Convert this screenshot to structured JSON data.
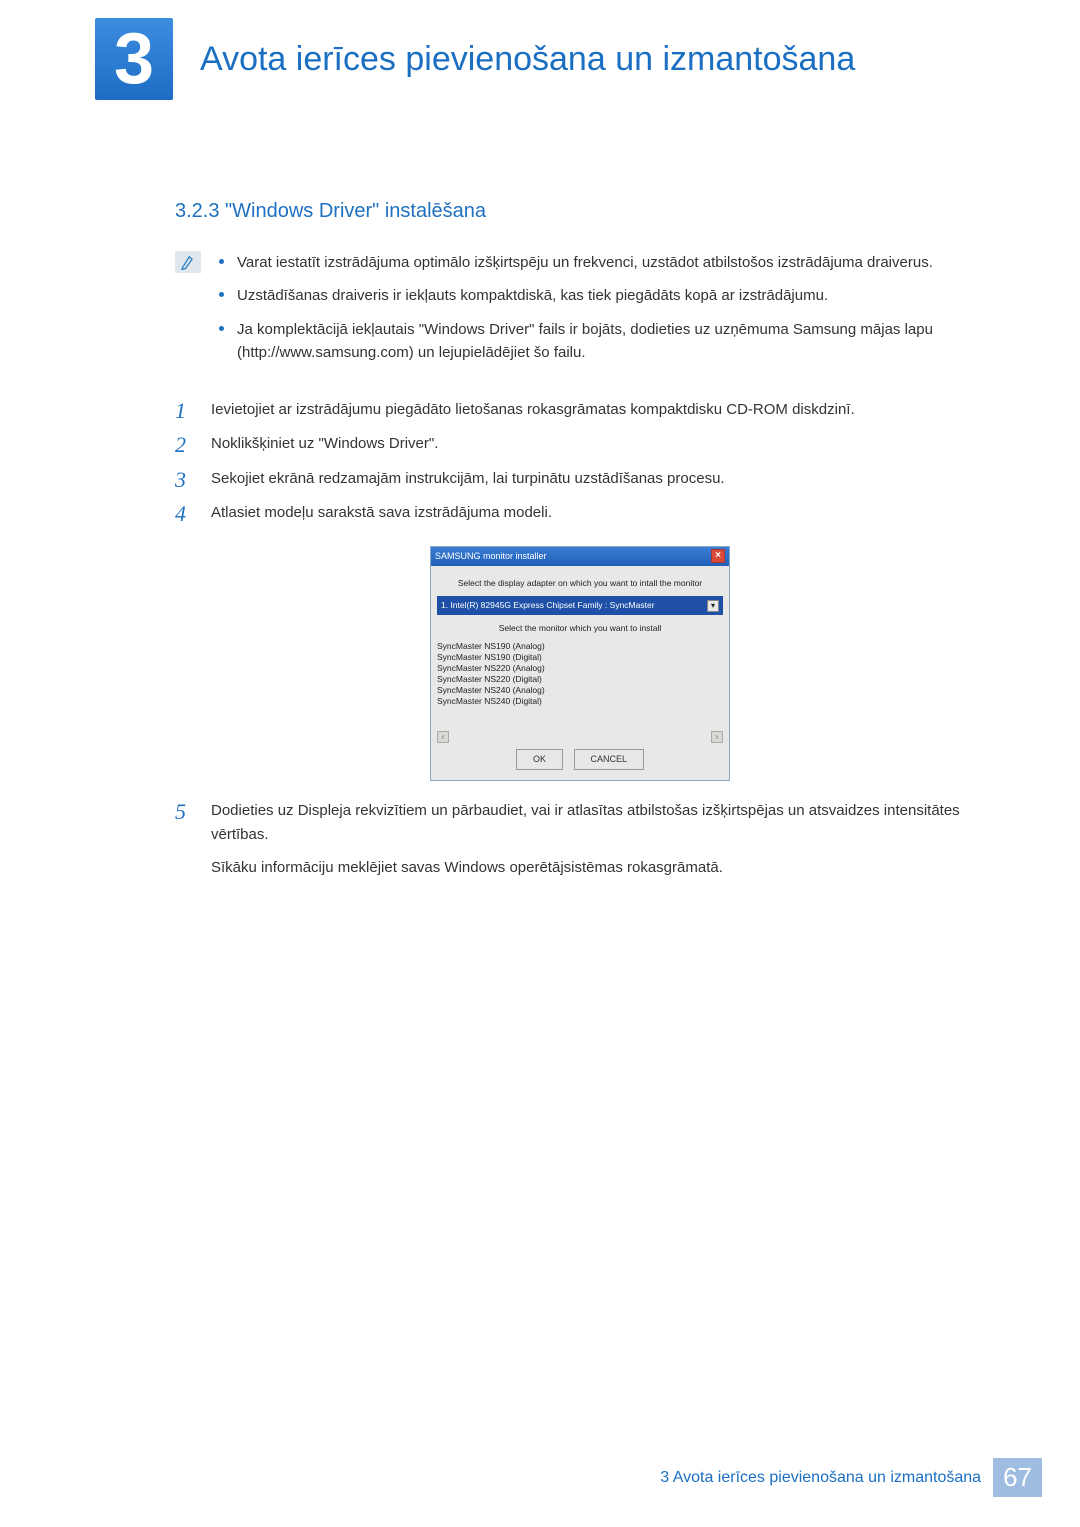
{
  "chapter": {
    "number": "3",
    "title": "Avota ierīces pievienošana un izmantošana"
  },
  "section": {
    "number": "3.2.3",
    "title": "\"Windows Driver\" instalēšana"
  },
  "info_bullets": [
    "Varat iestatīt izstrādājuma optimālo izšķirtspēju un frekvenci, uzstādot atbilstošos izstrādājuma draiverus.",
    "Uzstādīšanas draiveris ir iekļauts kompaktdiskā, kas tiek piegādāts kopā ar izstrādājumu.",
    "Ja komplektācijā iekļautais \"Windows Driver\" fails ir bojāts, dodieties uz uzņēmuma Samsung mājas lapu (http://www.samsung.com) un lejupielādējiet šo failu."
  ],
  "steps": [
    {
      "n": "1",
      "t": "Ievietojiet ar izstrādājumu piegādāto lietošanas rokasgrāmatas kompaktdisku CD-ROM diskdzinī."
    },
    {
      "n": "2",
      "t": "Noklikšķiniet uz \"Windows Driver\"."
    },
    {
      "n": "3",
      "t": "Sekojiet ekrānā redzamajām instrukcijām, lai turpinātu uzstādīšanas procesu."
    },
    {
      "n": "4",
      "t": "Atlasiet modeļu sarakstā sava izstrādājuma modeli."
    }
  ],
  "installer": {
    "title": "SAMSUNG monitor installer",
    "instr1": "Select the display adapter on which you want to intall the monitor",
    "dropdown": "1. Intel(R) 82945G Express Chipset Family : SyncMaster",
    "instr2": "Select the monitor which you want to install",
    "monitors": [
      "SyncMaster NS190 (Analog)",
      "SyncMaster NS190 (Digital)",
      "SyncMaster NS220 (Analog)",
      "SyncMaster NS220 (Digital)",
      "SyncMaster NS240 (Analog)",
      "SyncMaster NS240 (Digital)"
    ],
    "ok": "OK",
    "cancel": "CANCEL"
  },
  "step5": {
    "n": "5",
    "p1": "Dodieties uz Displeja rekvizītiem un pārbaudiet, vai ir atlasītas atbilstošas izšķirtspējas un atsvaidzes intensitātes vērtības.",
    "p2": "Sīkāku informāciju meklējiet savas Windows operētājsistēmas rokasgrāmatā."
  },
  "footer": {
    "text": "3 Avota ierīces pievienošana un izmantošana",
    "page": "67"
  }
}
